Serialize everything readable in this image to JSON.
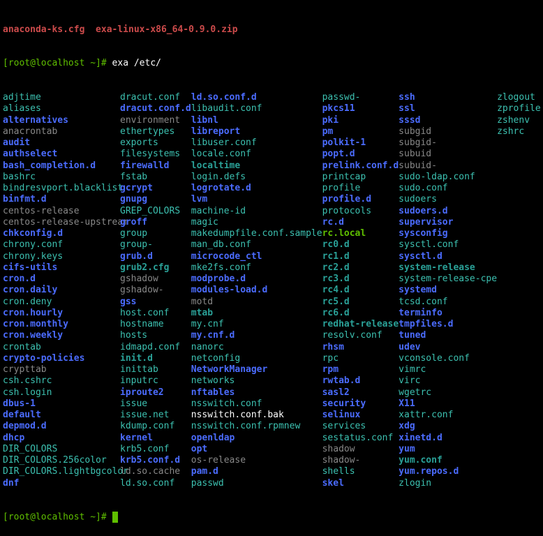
{
  "topline": "anaconda-ks.cfg  exa-linux-x86_64-0.9.0.zip",
  "prompt1": {
    "user": "[root@localhost ~]#",
    "cmd": " exa /etc/"
  },
  "prompt2": "[root@localhost ~]#",
  "listing": {
    "col0": [
      {
        "t": "adjtime",
        "c": "c-teal"
      },
      {
        "t": "aliases",
        "c": "c-teal"
      },
      {
        "t": "alternatives",
        "c": "c-blue"
      },
      {
        "t": "anacrontab",
        "c": "c-grey"
      },
      {
        "t": "audit",
        "c": "c-blue"
      },
      {
        "t": "authselect",
        "c": "c-blue"
      },
      {
        "t": "bash_completion.d",
        "c": "c-blue"
      },
      {
        "t": "bashrc",
        "c": "c-teal"
      },
      {
        "t": "bindresvport.blacklist",
        "c": "c-teal"
      },
      {
        "t": "binfmt.d",
        "c": "c-blue"
      },
      {
        "t": "centos-release",
        "c": "c-grey"
      },
      {
        "t": "centos-release-upstream",
        "c": "c-grey"
      },
      {
        "t": "chkconfig.d",
        "c": "c-blue"
      },
      {
        "t": "chrony.conf",
        "c": "c-teal"
      },
      {
        "t": "chrony.keys",
        "c": "c-teal"
      },
      {
        "t": "cifs-utils",
        "c": "c-blue"
      },
      {
        "t": "cron.d",
        "c": "c-blue"
      },
      {
        "t": "cron.daily",
        "c": "c-blue"
      },
      {
        "t": "cron.deny",
        "c": "c-teal"
      },
      {
        "t": "cron.hourly",
        "c": "c-blue"
      },
      {
        "t": "cron.monthly",
        "c": "c-blue"
      },
      {
        "t": "cron.weekly",
        "c": "c-blue"
      },
      {
        "t": "crontab",
        "c": "c-teal"
      },
      {
        "t": "crypto-policies",
        "c": "c-blue"
      },
      {
        "t": "crypttab",
        "c": "c-grey"
      },
      {
        "t": "csh.cshrc",
        "c": "c-teal"
      },
      {
        "t": "csh.login",
        "c": "c-teal"
      },
      {
        "t": "dbus-1",
        "c": "c-blue"
      },
      {
        "t": "default",
        "c": "c-blue"
      },
      {
        "t": "depmod.d",
        "c": "c-blue"
      },
      {
        "t": "dhcp",
        "c": "c-blue"
      },
      {
        "t": "DIR_COLORS",
        "c": "c-teal"
      },
      {
        "t": "DIR_COLORS.256color",
        "c": "c-teal"
      },
      {
        "t": "DIR_COLORS.lightbgcolor",
        "c": "c-teal"
      },
      {
        "t": "dnf",
        "c": "c-blue"
      }
    ],
    "col1": [
      {
        "t": "dracut.conf",
        "c": "c-teal"
      },
      {
        "t": "dracut.conf.d",
        "c": "c-blue"
      },
      {
        "t": "environment",
        "c": "c-grey"
      },
      {
        "t": "ethertypes",
        "c": "c-teal"
      },
      {
        "t": "exports",
        "c": "c-teal"
      },
      {
        "t": "filesystems",
        "c": "c-teal"
      },
      {
        "t": "firewalld",
        "c": "c-blue"
      },
      {
        "t": "fstab",
        "c": "c-teal"
      },
      {
        "t": "gcrypt",
        "c": "c-blue"
      },
      {
        "t": "gnupg",
        "c": "c-blue"
      },
      {
        "t": "GREP_COLORS",
        "c": "c-teal"
      },
      {
        "t": "groff",
        "c": "c-blue"
      },
      {
        "t": "group",
        "c": "c-teal"
      },
      {
        "t": "group-",
        "c": "c-teal"
      },
      {
        "t": "grub.d",
        "c": "c-blue"
      },
      {
        "t": "grub2.cfg",
        "c": "c-cyan"
      },
      {
        "t": "gshadow",
        "c": "c-grey"
      },
      {
        "t": "gshadow-",
        "c": "c-grey"
      },
      {
        "t": "gss",
        "c": "c-blue"
      },
      {
        "t": "host.conf",
        "c": "c-teal"
      },
      {
        "t": "hostname",
        "c": "c-teal"
      },
      {
        "t": "hosts",
        "c": "c-teal"
      },
      {
        "t": "idmapd.conf",
        "c": "c-teal"
      },
      {
        "t": "init.d",
        "c": "c-cyan"
      },
      {
        "t": "inittab",
        "c": "c-teal"
      },
      {
        "t": "inputrc",
        "c": "c-teal"
      },
      {
        "t": "iproute2",
        "c": "c-blue"
      },
      {
        "t": "issue",
        "c": "c-teal"
      },
      {
        "t": "issue.net",
        "c": "c-teal"
      },
      {
        "t": "kdump.conf",
        "c": "c-teal"
      },
      {
        "t": "kernel",
        "c": "c-blue"
      },
      {
        "t": "krb5.conf",
        "c": "c-teal"
      },
      {
        "t": "krb5.conf.d",
        "c": "c-blue"
      },
      {
        "t": "ld.so.cache",
        "c": "c-grey"
      },
      {
        "t": "ld.so.conf",
        "c": "c-teal"
      }
    ],
    "col2": [
      {
        "t": "ld.so.conf.d",
        "c": "c-blue"
      },
      {
        "t": "libaudit.conf",
        "c": "c-teal"
      },
      {
        "t": "libnl",
        "c": "c-blue"
      },
      {
        "t": "libreport",
        "c": "c-blue"
      },
      {
        "t": "libuser.conf",
        "c": "c-teal"
      },
      {
        "t": "locale.conf",
        "c": "c-teal"
      },
      {
        "t": "localtime",
        "c": "c-cyan"
      },
      {
        "t": "login.defs",
        "c": "c-teal"
      },
      {
        "t": "logrotate.d",
        "c": "c-blue"
      },
      {
        "t": "lvm",
        "c": "c-blue"
      },
      {
        "t": "machine-id",
        "c": "c-teal"
      },
      {
        "t": "magic",
        "c": "c-teal"
      },
      {
        "t": "makedumpfile.conf.sample",
        "c": "c-teal"
      },
      {
        "t": "man_db.conf",
        "c": "c-teal"
      },
      {
        "t": "microcode_ctl",
        "c": "c-blue"
      },
      {
        "t": "mke2fs.conf",
        "c": "c-teal"
      },
      {
        "t": "modprobe.d",
        "c": "c-blue"
      },
      {
        "t": "modules-load.d",
        "c": "c-blue"
      },
      {
        "t": "motd",
        "c": "c-grey"
      },
      {
        "t": "mtab",
        "c": "c-cyan"
      },
      {
        "t": "my.cnf",
        "c": "c-teal"
      },
      {
        "t": "my.cnf.d",
        "c": "c-blue"
      },
      {
        "t": "nanorc",
        "c": "c-teal"
      },
      {
        "t": "netconfig",
        "c": "c-teal"
      },
      {
        "t": "NetworkManager",
        "c": "c-blue"
      },
      {
        "t": "networks",
        "c": "c-teal"
      },
      {
        "t": "nftables",
        "c": "c-blue"
      },
      {
        "t": "nsswitch.conf",
        "c": "c-teal"
      },
      {
        "t": "nsswitch.conf.bak",
        "c": "c-white"
      },
      {
        "t": "nsswitch.conf.rpmnew",
        "c": "c-teal"
      },
      {
        "t": "openldap",
        "c": "c-blue"
      },
      {
        "t": "opt",
        "c": "c-blue"
      },
      {
        "t": "os-release",
        "c": "c-grey"
      },
      {
        "t": "pam.d",
        "c": "c-blue"
      },
      {
        "t": "passwd",
        "c": "c-teal"
      }
    ],
    "col3": [
      {
        "t": "passwd-",
        "c": "c-teal"
      },
      {
        "t": "pkcs11",
        "c": "c-blue"
      },
      {
        "t": "pki",
        "c": "c-blue"
      },
      {
        "t": "pm",
        "c": "c-blue"
      },
      {
        "t": "polkit-1",
        "c": "c-blue"
      },
      {
        "t": "popt.d",
        "c": "c-blue"
      },
      {
        "t": "prelink.conf.d",
        "c": "c-blue"
      },
      {
        "t": "printcap",
        "c": "c-teal"
      },
      {
        "t": "profile",
        "c": "c-teal"
      },
      {
        "t": "profile.d",
        "c": "c-blue"
      },
      {
        "t": "protocols",
        "c": "c-teal"
      },
      {
        "t": "rc.d",
        "c": "c-blue"
      },
      {
        "t": "rc.local",
        "c": "c-green-b"
      },
      {
        "t": "rc0.d",
        "c": "c-cyan"
      },
      {
        "t": "rc1.d",
        "c": "c-cyan"
      },
      {
        "t": "rc2.d",
        "c": "c-cyan"
      },
      {
        "t": "rc3.d",
        "c": "c-cyan"
      },
      {
        "t": "rc4.d",
        "c": "c-cyan"
      },
      {
        "t": "rc5.d",
        "c": "c-cyan"
      },
      {
        "t": "rc6.d",
        "c": "c-cyan"
      },
      {
        "t": "redhat-release",
        "c": "c-cyan"
      },
      {
        "t": "resolv.conf",
        "c": "c-teal"
      },
      {
        "t": "rhsm",
        "c": "c-blue"
      },
      {
        "t": "rpc",
        "c": "c-teal"
      },
      {
        "t": "rpm",
        "c": "c-blue"
      },
      {
        "t": "rwtab.d",
        "c": "c-blue"
      },
      {
        "t": "sasl2",
        "c": "c-blue"
      },
      {
        "t": "security",
        "c": "c-blue"
      },
      {
        "t": "selinux",
        "c": "c-blue"
      },
      {
        "t": "services",
        "c": "c-teal"
      },
      {
        "t": "sestatus.conf",
        "c": "c-teal"
      },
      {
        "t": "shadow",
        "c": "c-grey"
      },
      {
        "t": "shadow-",
        "c": "c-grey"
      },
      {
        "t": "shells",
        "c": "c-teal"
      },
      {
        "t": "skel",
        "c": "c-blue"
      }
    ],
    "col4": [
      {
        "t": "ssh",
        "c": "c-blue"
      },
      {
        "t": "ssl",
        "c": "c-blue"
      },
      {
        "t": "sssd",
        "c": "c-blue"
      },
      {
        "t": "subgid",
        "c": "c-grey"
      },
      {
        "t": "subgid-",
        "c": "c-grey"
      },
      {
        "t": "subuid",
        "c": "c-grey"
      },
      {
        "t": "subuid-",
        "c": "c-grey"
      },
      {
        "t": "sudo-ldap.conf",
        "c": "c-teal"
      },
      {
        "t": "sudo.conf",
        "c": "c-teal"
      },
      {
        "t": "sudoers",
        "c": "c-teal"
      },
      {
        "t": "sudoers.d",
        "c": "c-blue"
      },
      {
        "t": "supervisor",
        "c": "c-blue"
      },
      {
        "t": "sysconfig",
        "c": "c-blue"
      },
      {
        "t": "sysctl.conf",
        "c": "c-teal"
      },
      {
        "t": "sysctl.d",
        "c": "c-blue"
      },
      {
        "t": "system-release",
        "c": "c-cyan"
      },
      {
        "t": "system-release-cpe",
        "c": "c-teal"
      },
      {
        "t": "systemd",
        "c": "c-blue"
      },
      {
        "t": "tcsd.conf",
        "c": "c-teal"
      },
      {
        "t": "terminfo",
        "c": "c-blue"
      },
      {
        "t": "tmpfiles.d",
        "c": "c-blue"
      },
      {
        "t": "tuned",
        "c": "c-blue"
      },
      {
        "t": "udev",
        "c": "c-blue"
      },
      {
        "t": "vconsole.conf",
        "c": "c-teal"
      },
      {
        "t": "vimrc",
        "c": "c-teal"
      },
      {
        "t": "virc",
        "c": "c-teal"
      },
      {
        "t": "wgetrc",
        "c": "c-teal"
      },
      {
        "t": "X11",
        "c": "c-blue"
      },
      {
        "t": "xattr.conf",
        "c": "c-teal"
      },
      {
        "t": "xdg",
        "c": "c-blue"
      },
      {
        "t": "xinetd.d",
        "c": "c-blue"
      },
      {
        "t": "yum",
        "c": "c-blue"
      },
      {
        "t": "yum.conf",
        "c": "c-cyan"
      },
      {
        "t": "yum.repos.d",
        "c": "c-blue"
      },
      {
        "t": "zlogin",
        "c": "c-teal"
      }
    ],
    "col5": [
      {
        "t": "zlogout",
        "c": "c-teal"
      },
      {
        "t": "zprofile",
        "c": "c-teal"
      },
      {
        "t": "zshenv",
        "c": "c-teal"
      },
      {
        "t": "zshrc",
        "c": "c-teal"
      }
    ]
  }
}
